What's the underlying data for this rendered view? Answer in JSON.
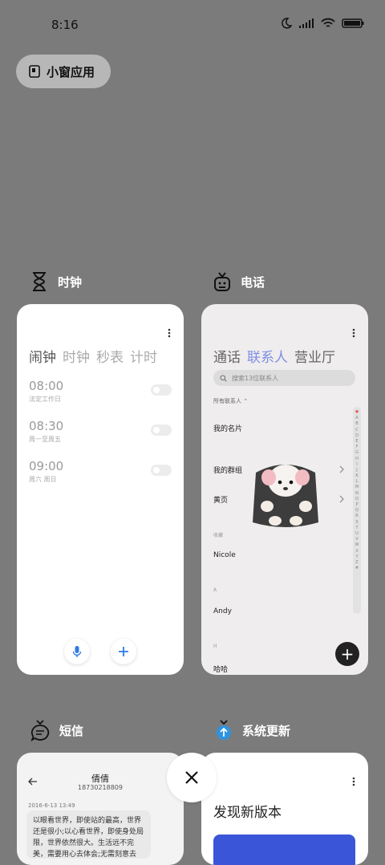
{
  "status": {
    "time": "8:16"
  },
  "small_window": {
    "label": "小窗应用"
  },
  "apps": {
    "clock": {
      "name": "时钟",
      "tabs": [
        "闹钟",
        "时钟",
        "秒表",
        "计时"
      ],
      "alarms": [
        {
          "time": "08:00",
          "sub": "法定工作日"
        },
        {
          "time": "08:30",
          "sub": "周一至周五"
        },
        {
          "time": "09:00",
          "sub": "周六 周日"
        }
      ],
      "add_label": "+"
    },
    "phone": {
      "name": "电话",
      "tabs": [
        "通话",
        "联系人",
        "营业厅"
      ],
      "search_placeholder": "搜索13位联系人",
      "all_contacts": "所有联系人",
      "items": {
        "my_card": "我的名片",
        "my_groups": "我的群组",
        "yellow_pages": "黄页",
        "fav_caption": "收藏",
        "nicole": "Nicole",
        "a_caption": "A",
        "andy": "Andy",
        "h_caption": "H",
        "haha": "哈哈"
      },
      "alphabet": [
        "♥",
        "A",
        "B",
        "C",
        "D",
        "E",
        "F",
        "G",
        "H",
        "I",
        "J",
        "K",
        "L",
        "M",
        "N",
        "O",
        "P",
        "Q",
        "R",
        "S",
        "T",
        "U",
        "V",
        "W",
        "X",
        "Y",
        "Z",
        "#"
      ],
      "fab_label": "+"
    },
    "sms": {
      "name": "短信",
      "contact_name": "倩倩",
      "contact_number": "18730218809",
      "date": "2016-6-13 13:49",
      "message": "以眼看世界，即使站的最高，世界还是很小;以心看世界，即使身处局限，世界依然很大。生活远不完美，需要用心去体会;无需刻意去"
    },
    "update": {
      "name": "系统更新",
      "title": "发现新版本"
    }
  },
  "colors": {
    "background": "#7b7b7b",
    "accent": "#7f8ee6",
    "update_blue": "#3b55d8"
  }
}
